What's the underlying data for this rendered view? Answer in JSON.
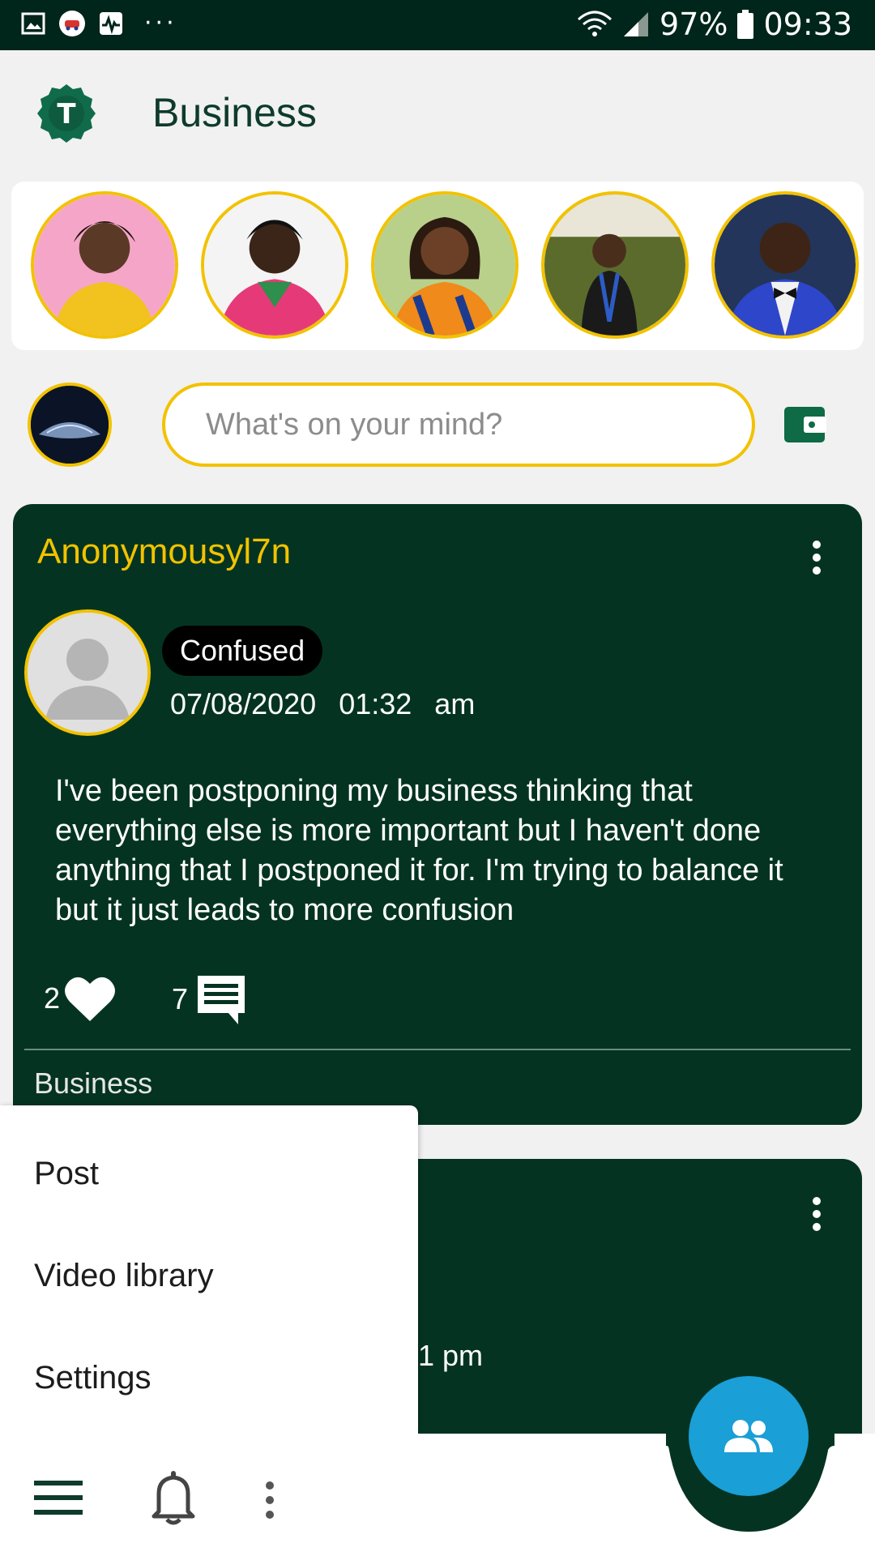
{
  "status_bar": {
    "battery": "97%",
    "time": "09:33",
    "more": "···"
  },
  "header": {
    "title": "Business",
    "logo_letter": "T"
  },
  "composer": {
    "placeholder": "What's on your mind?"
  },
  "posts": [
    {
      "author": "Anonymousyl7n",
      "mood": "Confused",
      "date": "07/08/2020",
      "time": "01:32 am",
      "body": "I've been postponing my business thinking that everything else is more important but I haven't done anything that I postponed it for. I'm trying to balance it but it just leads to more confusion",
      "likes": "2",
      "comments": "7",
      "category": "Business"
    },
    {
      "time_partial": "1 pm"
    }
  ],
  "menu": {
    "items": [
      "Post",
      "Video library",
      "Settings"
    ]
  },
  "colors": {
    "primary": "#043421",
    "accent": "#f2c200",
    "fab": "#1a9fd6",
    "status_bar": "#00251a"
  }
}
